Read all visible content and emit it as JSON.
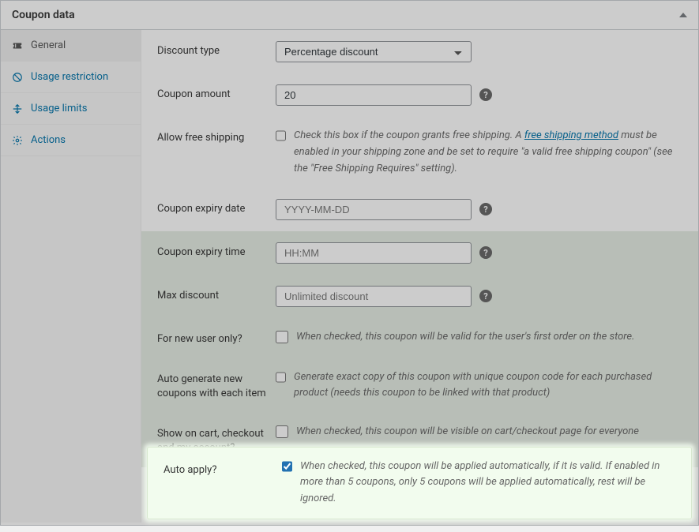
{
  "panel": {
    "title": "Coupon data"
  },
  "sidebar": {
    "items": [
      {
        "label": "General"
      },
      {
        "label": "Usage restriction"
      },
      {
        "label": "Usage limits"
      },
      {
        "label": "Actions"
      }
    ]
  },
  "fields": {
    "discount_type": {
      "label": "Discount type",
      "value": "Percentage discount"
    },
    "coupon_amount": {
      "label": "Coupon amount",
      "value": "20"
    },
    "free_shipping": {
      "label": "Allow free shipping",
      "desc_pre": "Check this box if the coupon grants free shipping. A ",
      "link": "free shipping method",
      "desc_post": " must be enabled in your shipping zone and be set to require \"a valid free shipping coupon\" (see the \"Free Shipping Requires\" setting)."
    },
    "expiry_date": {
      "label": "Coupon expiry date",
      "placeholder": "YYYY-MM-DD"
    },
    "expiry_time": {
      "label": "Coupon expiry time",
      "placeholder": "HH:MM"
    },
    "max_discount": {
      "label": "Max discount",
      "placeholder": "Unlimited discount"
    },
    "new_user": {
      "label": "For new user only?",
      "desc": "When checked, this coupon will be valid for the user's first order on the store."
    },
    "auto_gen": {
      "label": "Auto generate new coupons with each item",
      "desc": "Generate exact copy of this coupon with unique coupon code for each purchased product (needs this coupon to be linked with that product)"
    },
    "show_cart": {
      "label": "Show on cart, checkout and my account?",
      "desc": "When checked, this coupon will be visible on cart/checkout page for everyone"
    },
    "auto_apply": {
      "label": "Auto apply?",
      "desc": "When checked, this coupon will be applied automatically, if it is valid. If enabled in more than 5 coupons, only 5 coupons will be applied automatically, rest will be ignored."
    }
  }
}
